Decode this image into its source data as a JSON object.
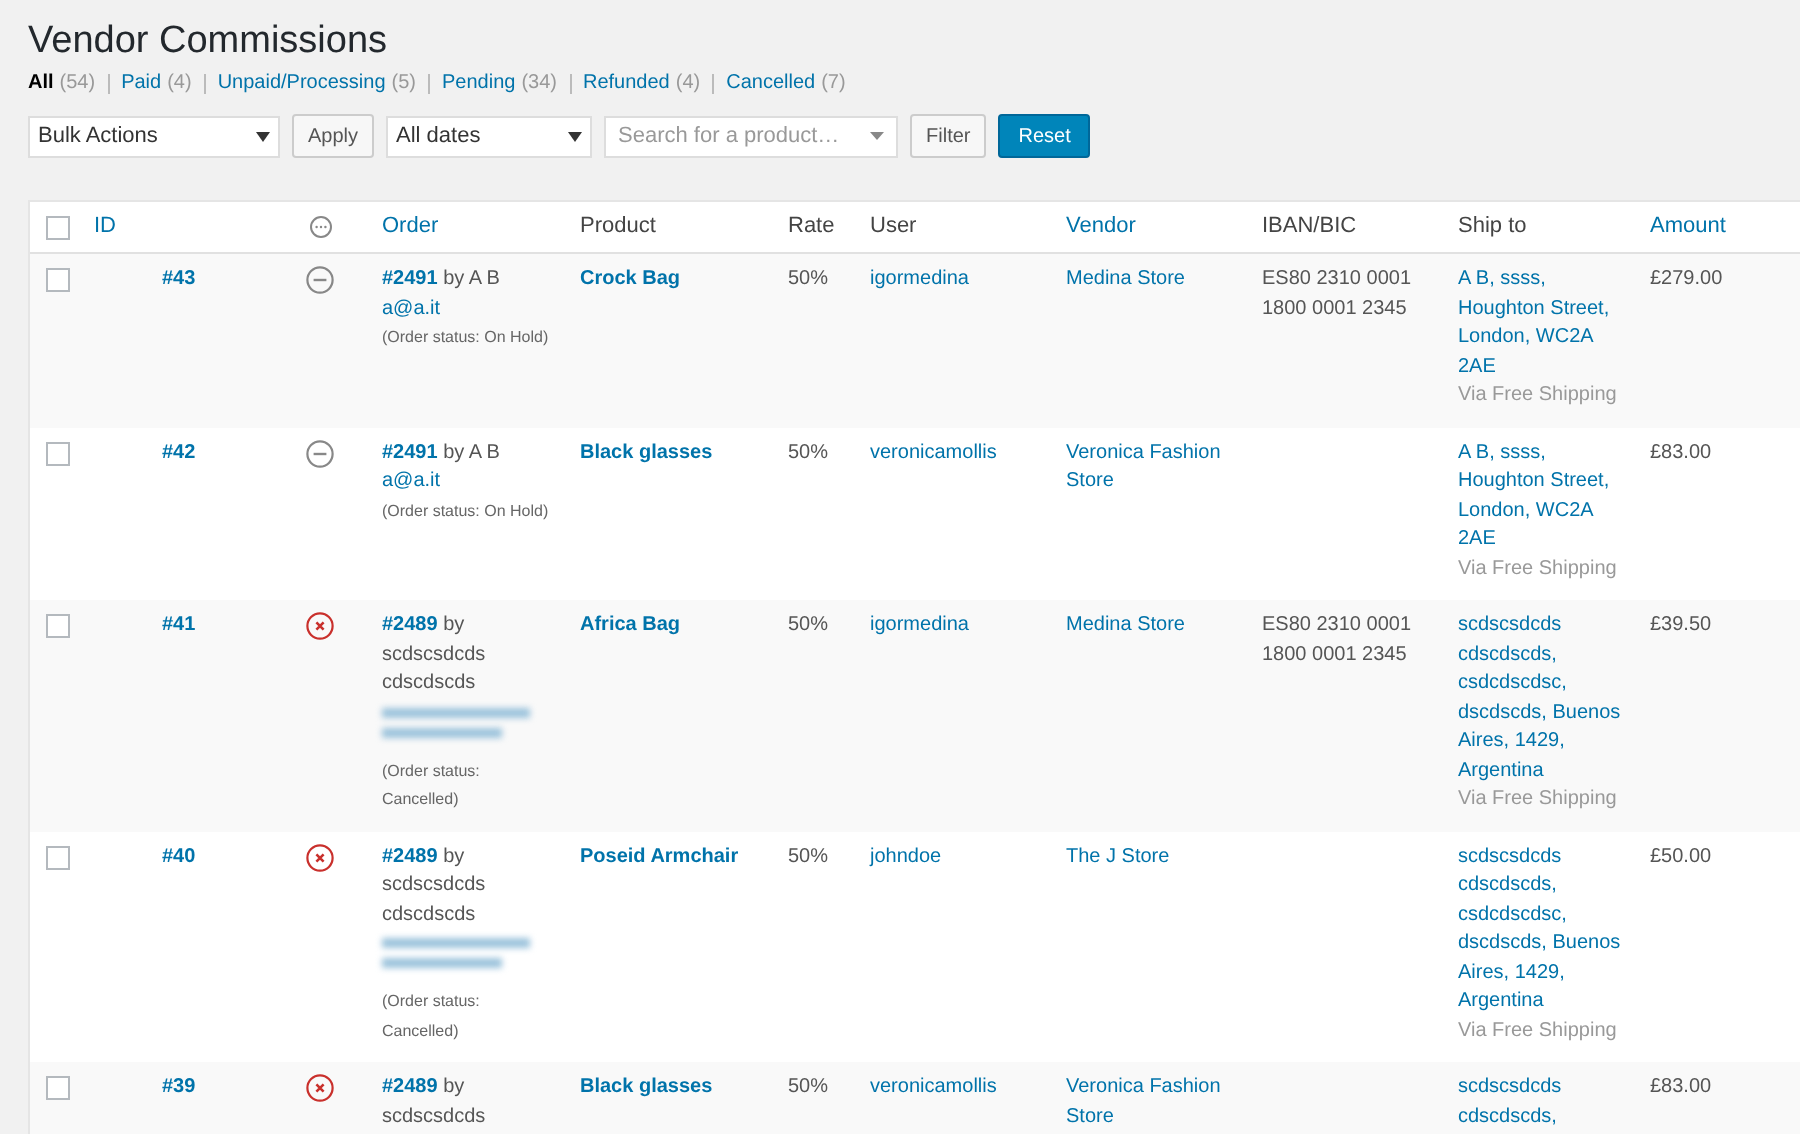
{
  "title": "Vendor Commissions",
  "filters": [
    {
      "label": "All",
      "count": "(54)",
      "selected": true
    },
    {
      "label": "Paid",
      "count": "(4)",
      "selected": false
    },
    {
      "label": "Unpaid/Processing",
      "count": "(5)",
      "selected": false
    },
    {
      "label": "Pending",
      "count": "(34)",
      "selected": false
    },
    {
      "label": "Refunded",
      "count": "(4)",
      "selected": false
    },
    {
      "label": "Cancelled",
      "count": "(7)",
      "selected": false
    }
  ],
  "toolbar": {
    "bulk_actions": "Bulk Actions",
    "apply": "Apply",
    "dates": "All dates",
    "product_search": {
      "placeholder": "Search for a product…"
    },
    "filter": "Filter",
    "reset": "Reset"
  },
  "columns": [
    {
      "kind": "checkbox",
      "checked": false
    },
    {
      "kind": "text",
      "label": "ID",
      "sortable": true
    },
    {
      "kind": "status_icon"
    },
    {
      "kind": "text",
      "label": "Order",
      "sortable": true
    },
    {
      "kind": "text",
      "label": "Product",
      "sortable": false
    },
    {
      "kind": "text",
      "label": "Rate",
      "sortable": false
    },
    {
      "kind": "text",
      "label": "User",
      "sortable": false
    },
    {
      "kind": "text",
      "label": "Vendor",
      "sortable": true
    },
    {
      "kind": "text",
      "label": "IBAN/BIC",
      "sortable": false
    },
    {
      "kind": "text",
      "label": "Ship to",
      "sortable": false
    },
    {
      "kind": "text",
      "label": "Amount",
      "sortable": true
    }
  ],
  "rows": [
    {
      "checked": false,
      "id": "#43",
      "kind": "on_hold",
      "order": "#2491",
      "by": "by A B",
      "email": "a@a.it",
      "order_status": "(Order status: On Hold)",
      "product": "Crock Bag",
      "rate": "50%",
      "user": "igormedina",
      "vendor": "Medina Store",
      "iban": "ES80 2310 0001 1800 0001 2345",
      "ship_to": "A B, ssss, Houghton Street, London, WC2A 2AE",
      "shipping": "Via Free Shipping",
      "amount": "£279.00"
    },
    {
      "checked": false,
      "id": "#42",
      "kind": "on_hold",
      "order": "#2491",
      "by": "by A B",
      "email": "a@a.it",
      "order_status": "(Order status: On Hold)",
      "product": "Black glasses",
      "rate": "50%",
      "user": "veronicamollis",
      "vendor": "Veronica Fashion Store",
      "ship_to": "A B, ssss, Houghton Street, London, WC2A 2AE",
      "shipping": "Via Free Shipping",
      "amount": "£83.00"
    },
    {
      "checked": false,
      "id": "#41",
      "kind": "cancelled",
      "order": "#2489",
      "by": "by scdscsdcds cdscdscds",
      "email_obscured": true,
      "order_status": "(Order status: Cancelled)",
      "product": "Africa Bag",
      "rate": "50%",
      "user": "igormedina",
      "vendor": "Medina Store",
      "iban": "ES80 2310 0001 1800 0001 2345",
      "ship_to": "scdscsdcds cdscdscds, csdcdscdsc, dscdscds, Buenos Aires, 1429, Argentina",
      "shipping": "Via Free Shipping",
      "amount": "£39.50"
    },
    {
      "checked": false,
      "id": "#40",
      "kind": "cancelled",
      "order": "#2489",
      "by": "by scdscsdcds cdscdscds",
      "email_obscured": true,
      "order_status": "(Order status: Cancelled)",
      "product": "Poseid Armchair",
      "rate": "50%",
      "user": "johndoe",
      "vendor": "The J Store",
      "ship_to": "scdscsdcds cdscdscds, csdcdscdsc, dscdscds, Buenos Aires, 1429, Argentina",
      "shipping": "Via Free Shipping",
      "amount": "£50.00"
    },
    {
      "checked": false,
      "id": "#39",
      "kind": "cancelled",
      "order": "#2489",
      "by": "by scdscsdcds",
      "product": "Black glasses",
      "rate": "50%",
      "user": "veronicamollis",
      "vendor": "Veronica Fashion Store",
      "ship_to": "scdscsdcds cdscdscds,",
      "amount": "£83.00"
    }
  ]
}
